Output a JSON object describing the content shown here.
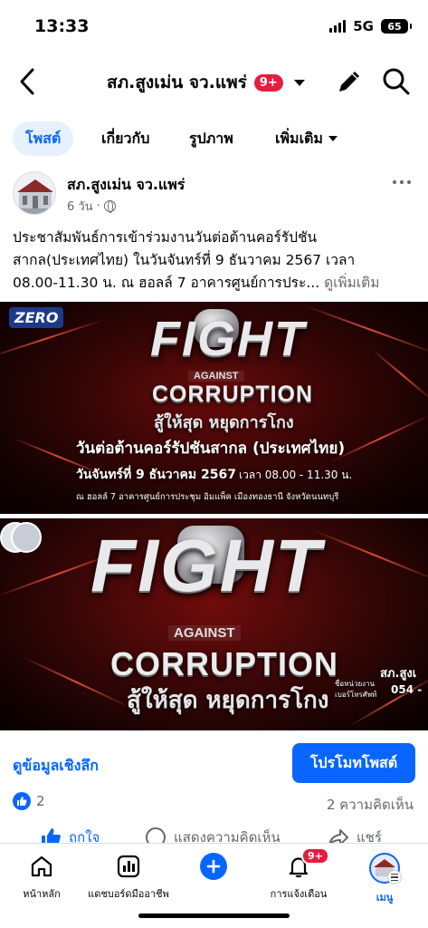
{
  "status_bar": {
    "time": "13:33",
    "network": "5G",
    "battery": "65"
  },
  "header": {
    "page_name": "สภ.สูงเม่น จว.แพร่",
    "badge": "9+"
  },
  "tabs": [
    {
      "label": "โพสต์",
      "active": true
    },
    {
      "label": "เกี่ยวกับ"
    },
    {
      "label": "รูปภาพ"
    },
    {
      "label": "เพิ่มเติม"
    }
  ],
  "post": {
    "author": "สภ.สูงเม่น จว.แพร่",
    "time": "6 วัน",
    "text_line1": "ประชาสัมพันธ์การเข้าร่วมงานวันต่อต้านคอร์รัปชัน",
    "text_line2": "สากล(ประเทศไทย) ในวันจันทร์ที่ 9 ธันวาคม 2567 เวลา",
    "text_line3": "08.00-11.30 น. ณ ฮอลล์ 7 อาคารศูนย์การประ...",
    "see_more": "ดูเพิ่มเติม"
  },
  "image1": {
    "logo": "ZERO",
    "fight": "FIGHT",
    "against": "AGAINST",
    "corruption": "CORRUPTION",
    "slogan": "สู้ให้สุด หยุดการโกง",
    "event_title": "วันต่อต้านคอร์รัปชันสากล (ประเทศไทย)",
    "event_date": "วันจันทร์ที่ 9 ธันวาคม 2567",
    "event_time": "เวลา 08.00 - 11.30 น.",
    "event_venue": "ณ ฮอลล์ 7 อาคารศูนย์การประชุม อิมแพ็ค เมืองทองธานี จังหวัดนนทบุรี"
  },
  "image2": {
    "fight": "FIGHT",
    "against": "AGAINST",
    "corruption": "CORRUPTION",
    "slogan": "สู้ให้สุด หยุดการโกง",
    "corner_unit": "สภ.สูงเ",
    "corner_line1": "ชื่อหน่วยงาน",
    "corner_line2": "เบอร์โทรศัพท์",
    "corner_phone": "054 -"
  },
  "insights": {
    "link": "ดูข้อมูลเชิงลึก",
    "promote": "โปรโมทโพสต์"
  },
  "reactions": {
    "likes": "2",
    "comments": "2 ความคิดเห็น"
  },
  "actions": {
    "like": "ถูกใจ",
    "comment": "แสดงความคิดเห็น",
    "share": "แชร์"
  },
  "bottom_nav": {
    "home": "หน้าหลัก",
    "dashboard": "แดชบอร์ดมืออาชีพ",
    "notifications": "การแจ้งเตือน",
    "notifications_badge": "9+",
    "menu": "เมนู"
  },
  "colors": {
    "accent": "#0866ff",
    "badge": "#e41e3f",
    "muted": "#65676b"
  }
}
